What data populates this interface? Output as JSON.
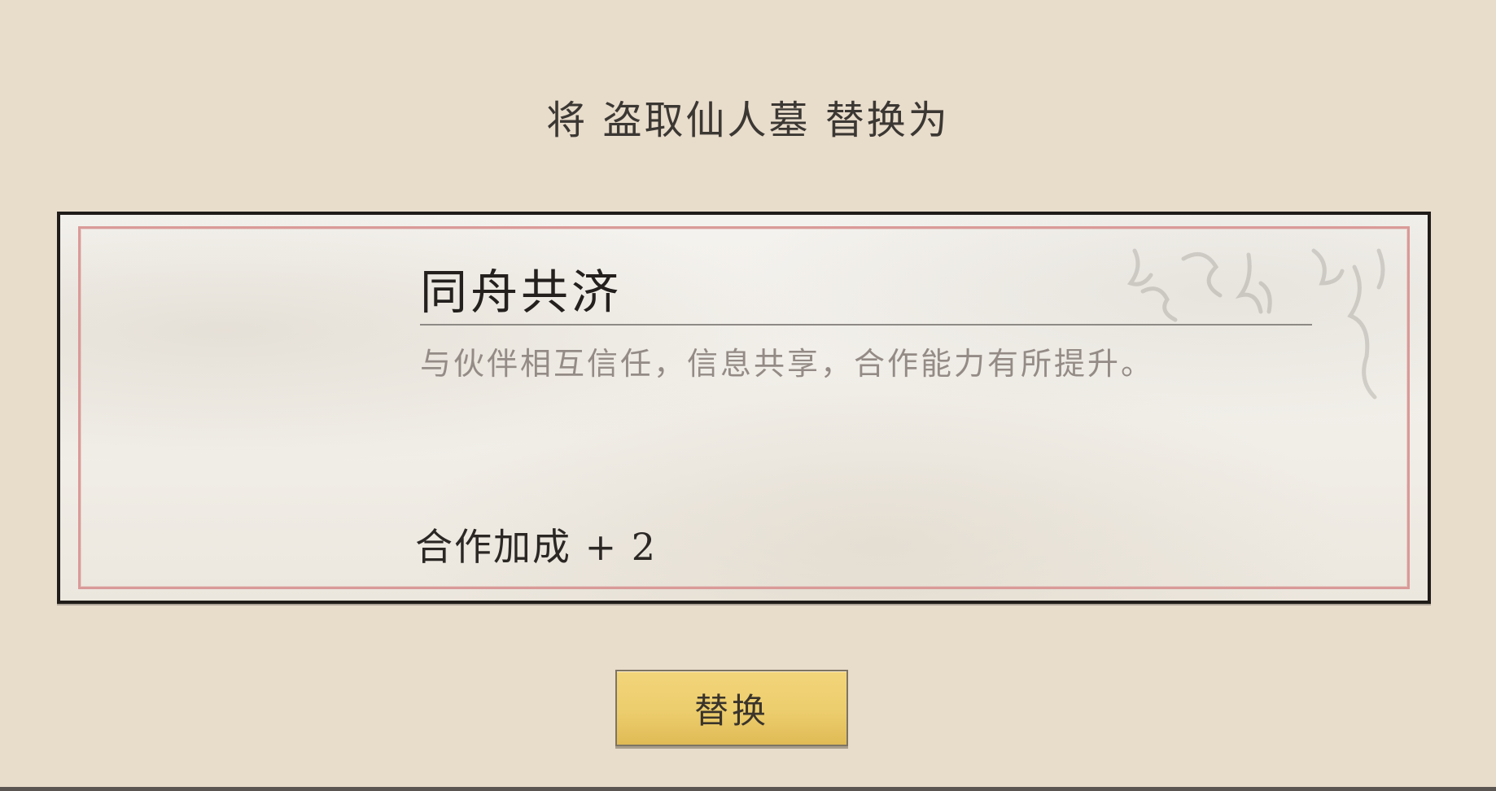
{
  "prompt": {
    "title": "将 盗取仙人墓 替换为"
  },
  "card": {
    "title": "同舟共济",
    "description": "与伙伴相互信任，信息共享，合作能力有所提升。",
    "bonus": "合作加成 + 2"
  },
  "actions": {
    "replace_label": "替换"
  },
  "colors": {
    "background": "#e8dccb",
    "card_paper": "#f3f0eb",
    "card_outer_border": "#1f1c1a",
    "card_inner_border": "#d99a98",
    "button_gold": "#eccd6d"
  }
}
